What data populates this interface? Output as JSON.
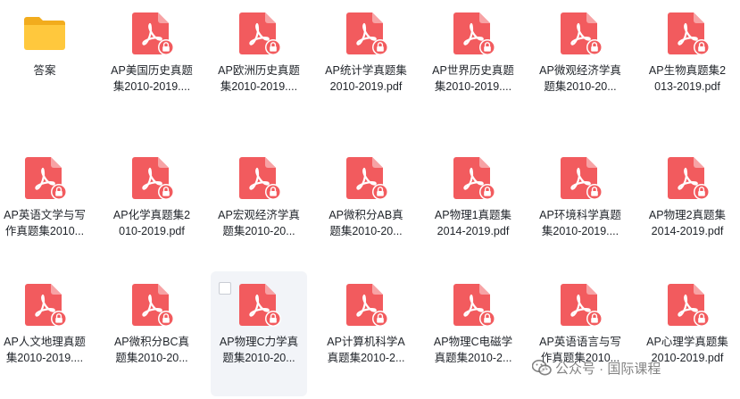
{
  "colors": {
    "pdf_red": "#f25b5e",
    "folder_yellow": "#ffc83d",
    "text": "#1f2329"
  },
  "items": [
    {
      "type": "folder",
      "icon": "folder-icon",
      "lines": [
        "答案"
      ]
    },
    {
      "type": "pdf",
      "icon": "pdf-lock-icon",
      "lines": [
        "AP美国历史真题",
        "集2010-2019...."
      ]
    },
    {
      "type": "pdf",
      "icon": "pdf-lock-icon",
      "lines": [
        "AP欧洲历史真题",
        "集2010-2019...."
      ]
    },
    {
      "type": "pdf",
      "icon": "pdf-lock-icon",
      "lines": [
        "AP统计学真题集",
        "2010-2019.pdf"
      ]
    },
    {
      "type": "pdf",
      "icon": "pdf-lock-icon",
      "lines": [
        "AP世界历史真题",
        "集2010-2019...."
      ]
    },
    {
      "type": "pdf",
      "icon": "pdf-lock-icon",
      "lines": [
        "AP微观经济学真",
        "题集2010-20..."
      ]
    },
    {
      "type": "pdf",
      "icon": "pdf-lock-icon",
      "lines": [
        "AP生物真题集2",
        "013-2019.pdf"
      ]
    },
    {
      "type": "pdf",
      "icon": "pdf-lock-icon",
      "lines": [
        "AP英语文学与写",
        "作真题集2010..."
      ]
    },
    {
      "type": "pdf",
      "icon": "pdf-lock-icon",
      "lines": [
        "AP化学真题集2",
        "010-2019.pdf"
      ]
    },
    {
      "type": "pdf",
      "icon": "pdf-lock-icon",
      "lines": [
        "AP宏观经济学真",
        "题集2010-20..."
      ]
    },
    {
      "type": "pdf",
      "icon": "pdf-lock-icon",
      "lines": [
        "AP微积分AB真",
        "题集2010-20..."
      ]
    },
    {
      "type": "pdf",
      "icon": "pdf-lock-icon",
      "lines": [
        "AP物理1真题集",
        "2014-2019.pdf"
      ]
    },
    {
      "type": "pdf",
      "icon": "pdf-lock-icon",
      "lines": [
        "AP环境科学真题",
        "集2010-2019...."
      ]
    },
    {
      "type": "pdf",
      "icon": "pdf-lock-icon",
      "lines": [
        "AP物理2真题集",
        "2014-2019.pdf"
      ]
    },
    {
      "type": "pdf",
      "icon": "pdf-lock-icon",
      "lines": [
        "AP人文地理真题",
        "集2010-2019...."
      ]
    },
    {
      "type": "pdf",
      "icon": "pdf-lock-icon",
      "lines": [
        "AP微积分BC真",
        "题集2010-20..."
      ]
    },
    {
      "type": "pdf",
      "icon": "pdf-lock-icon",
      "lines": [
        "AP物理C力学真",
        "题集2010-20..."
      ],
      "selected": true
    },
    {
      "type": "pdf",
      "icon": "pdf-lock-icon",
      "lines": [
        "AP计算机科学A",
        "真题集2010-2..."
      ]
    },
    {
      "type": "pdf",
      "icon": "pdf-lock-icon",
      "lines": [
        "AP物理C电磁学",
        "真题集2010-2..."
      ]
    },
    {
      "type": "pdf",
      "icon": "pdf-lock-icon",
      "lines": [
        "AP英语语言与写",
        "作真题集2010..."
      ]
    },
    {
      "type": "pdf",
      "icon": "pdf-lock-icon",
      "lines": [
        "AP心理学真题集",
        "2010-2019.pdf"
      ]
    }
  ],
  "watermark": {
    "icon": "wechat-icon",
    "text": "公众号 · 国际课程"
  }
}
